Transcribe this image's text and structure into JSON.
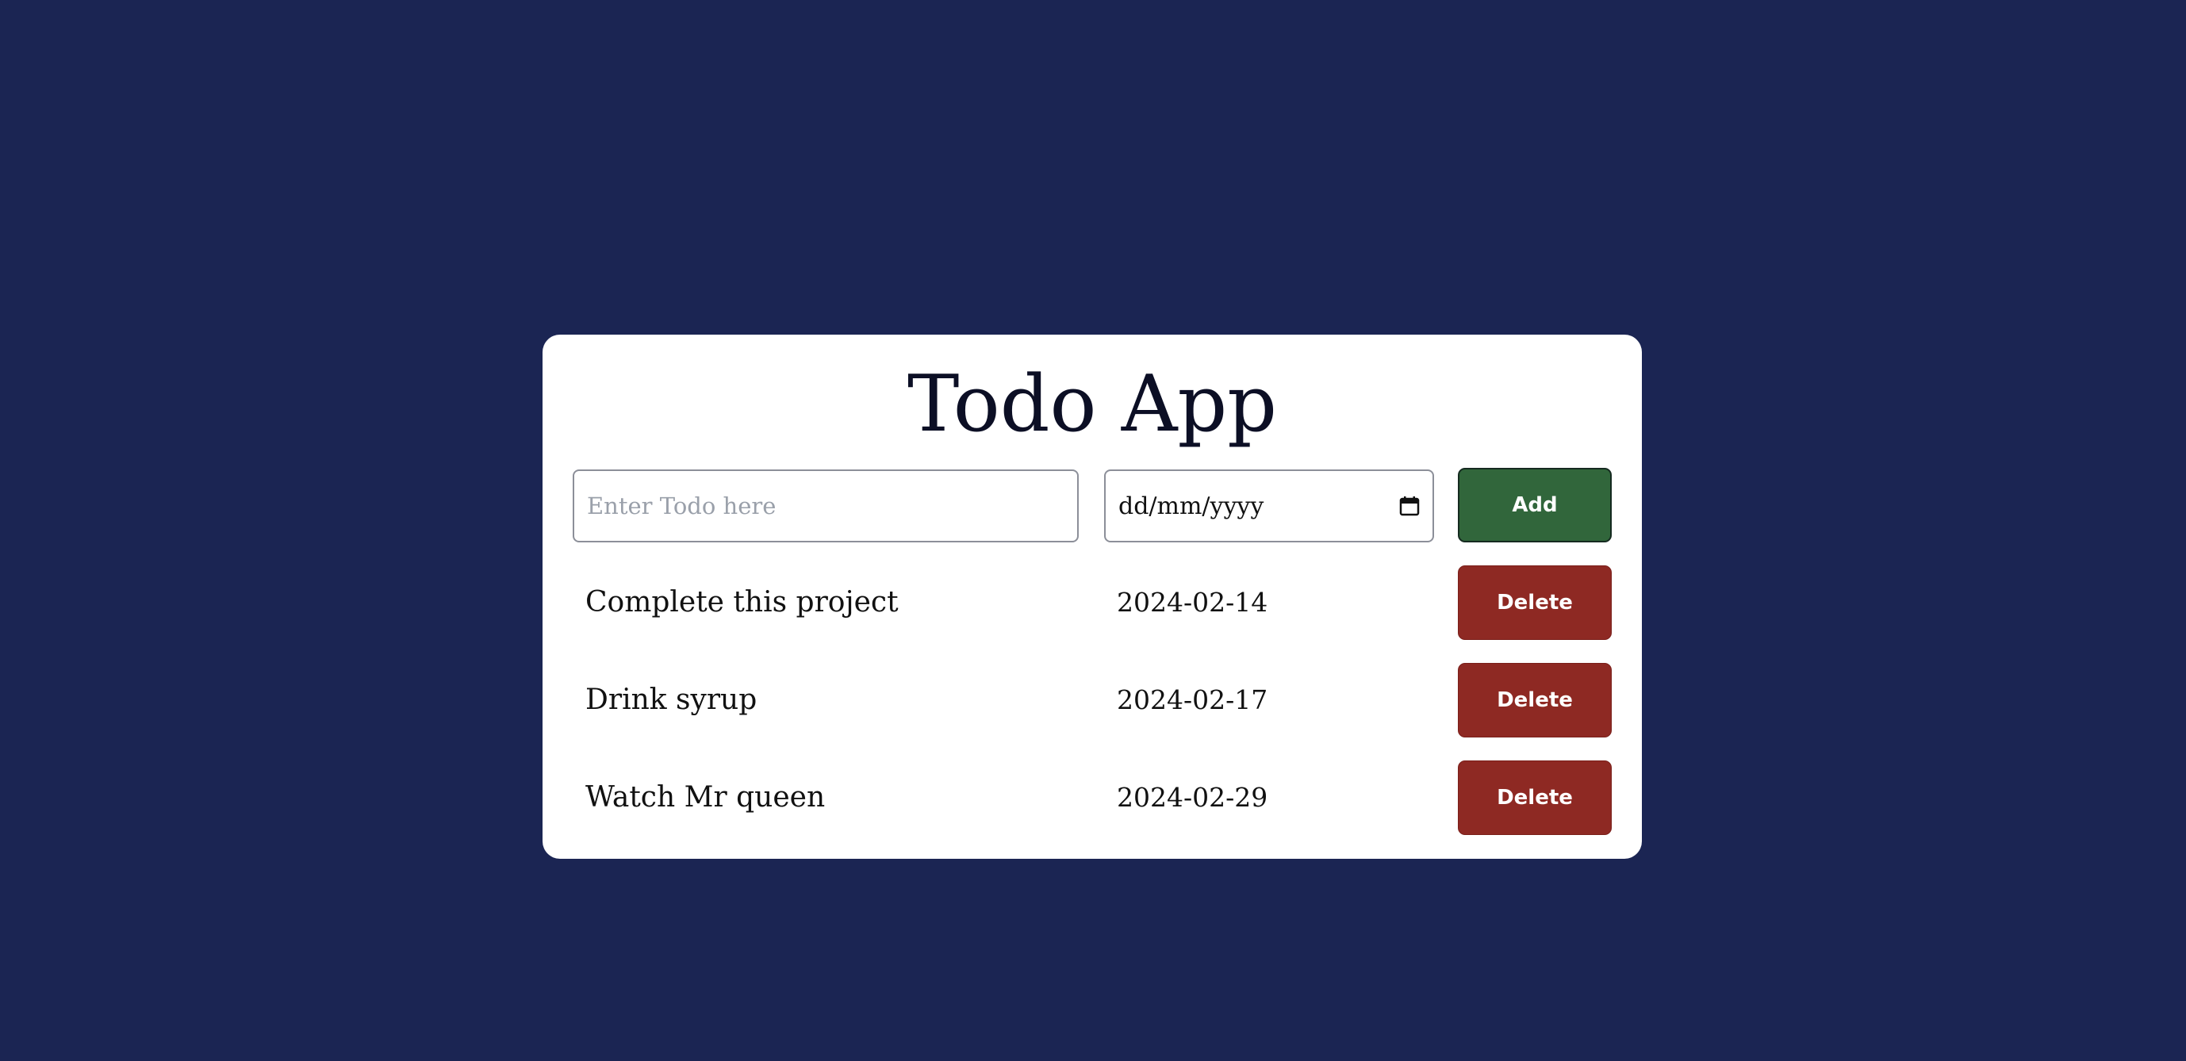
{
  "app": {
    "title": "Todo App"
  },
  "form": {
    "todo_placeholder": "Enter Todo here",
    "date_placeholder": "dd/mm/yyyy",
    "add_label": "Add"
  },
  "todos": [
    {
      "name": "Complete this project",
      "date": "2024-02-14",
      "delete_label": "Delete"
    },
    {
      "name": "Drink syrup",
      "date": "2024-02-17",
      "delete_label": "Delete"
    },
    {
      "name": "Watch Mr queen",
      "date": "2024-02-29",
      "delete_label": "Delete"
    }
  ],
  "colors": {
    "background": "#1b2553",
    "card": "#ffffff",
    "add_button": "#31663b",
    "delete_button": "#8e2923"
  },
  "icons": {
    "date_picker": "calendar-icon"
  }
}
